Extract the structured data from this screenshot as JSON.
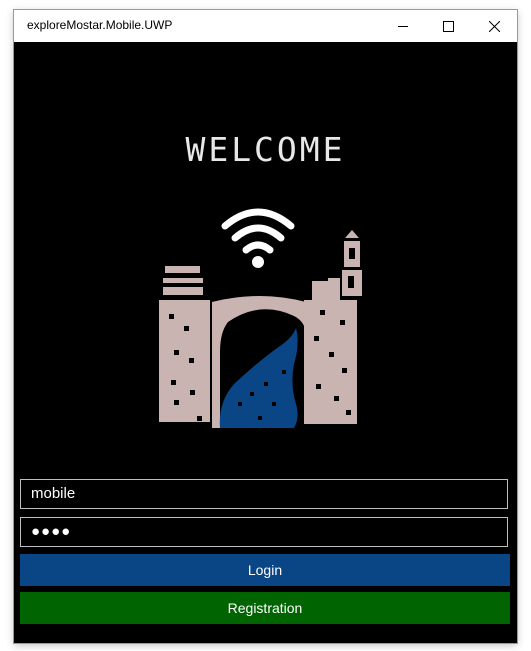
{
  "window": {
    "title": "exploreMostar.Mobile.UWP"
  },
  "welcome": {
    "heading": "WELCOME"
  },
  "form": {
    "username_value": "mobile",
    "password_value": "●●●●",
    "login_label": "Login",
    "registration_label": "Registration"
  },
  "colors": {
    "login_button": "#0a4585",
    "registration_button": "#006400",
    "logo_buildings": "#c9b4b2",
    "logo_river": "#0a4585"
  },
  "icons": {
    "logo": "mostar-bridge-wifi-logo"
  }
}
